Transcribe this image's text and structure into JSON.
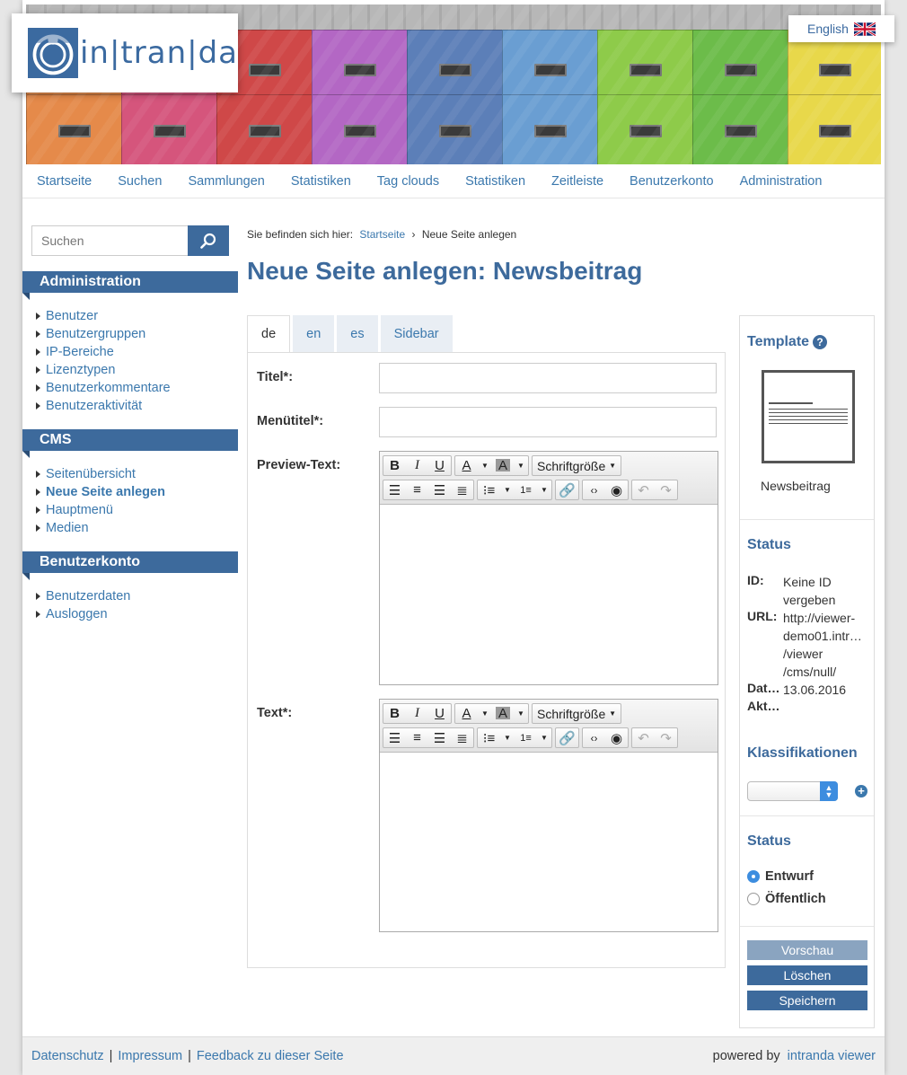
{
  "header": {
    "logo_text": "in|tran|da",
    "language_label": "English"
  },
  "nav": [
    "Startseite",
    "Suchen",
    "Sammlungen",
    "Statistiken",
    "Tag clouds",
    "Statistiken",
    "Zeitleiste",
    "Benutzerkonto",
    "Administration"
  ],
  "sidebar": {
    "search_placeholder": "Suchen",
    "sections": [
      {
        "title": "Administration",
        "items": [
          "Benutzer",
          "Benutzergruppen",
          "IP-Bereiche",
          "Lizenztypen",
          "Benutzerkommentare",
          "Benutzeraktivität"
        ]
      },
      {
        "title": "CMS",
        "items": [
          "Seitenübersicht",
          "Neue Seite anlegen",
          "Hauptmenü",
          "Medien"
        ],
        "active": "Neue Seite anlegen"
      },
      {
        "title": "Benutzerkonto",
        "items": [
          "Benutzerdaten",
          "Ausloggen"
        ]
      }
    ]
  },
  "breadcrumb": {
    "prefix": "Sie befinden sich hier:",
    "home": "Startseite",
    "separator": "›",
    "current": "Neue Seite anlegen"
  },
  "page_title": "Neue Seite anlegen: Newsbeitrag",
  "tabs": [
    {
      "label": "de",
      "active": true
    },
    {
      "label": "en",
      "active": false
    },
    {
      "label": "es",
      "active": false
    },
    {
      "label": "Sidebar",
      "active": false
    }
  ],
  "form": {
    "title_label": "Titel*:",
    "title_value": "",
    "menu_title_label": "Menütitel*:",
    "menu_title_value": "",
    "preview_label": "Preview-Text:",
    "text_label": "Text*:",
    "toolbar": {
      "bold": "B",
      "italic": "I",
      "underline": "U",
      "font_color": "A",
      "highlight": "A",
      "font_size": "Schriftgröße"
    }
  },
  "right_panel": {
    "template_title": "Template",
    "template_name": "Newsbeitrag",
    "status_title": "Status",
    "id_label": "ID:",
    "id_value": "Keine ID vergeben",
    "url_label": "URL:",
    "url_value_lines": [
      "http://viewer-",
      "demo01.intr…",
      "/viewer",
      "/cms/null/"
    ],
    "date_label": "Dat…",
    "date_label_2": "Akt…",
    "date_value": "13.06.2016",
    "classification_title": "Klassifikationen",
    "publish_title": "Status",
    "radio_draft": "Entwurf",
    "radio_public": "Öffentlich",
    "btn_preview": "Vorschau",
    "btn_delete": "Löschen",
    "btn_save": "Speichern"
  },
  "footer": {
    "links": [
      "Datenschutz",
      "Impressum",
      "Feedback zu dieser Seite"
    ],
    "powered_prefix": "powered by",
    "powered_link": "intranda viewer"
  },
  "colors": {
    "brand_blue": "#3d6a9c",
    "link_blue": "#3b78ad",
    "radio_blue": "#3d8ddf"
  }
}
